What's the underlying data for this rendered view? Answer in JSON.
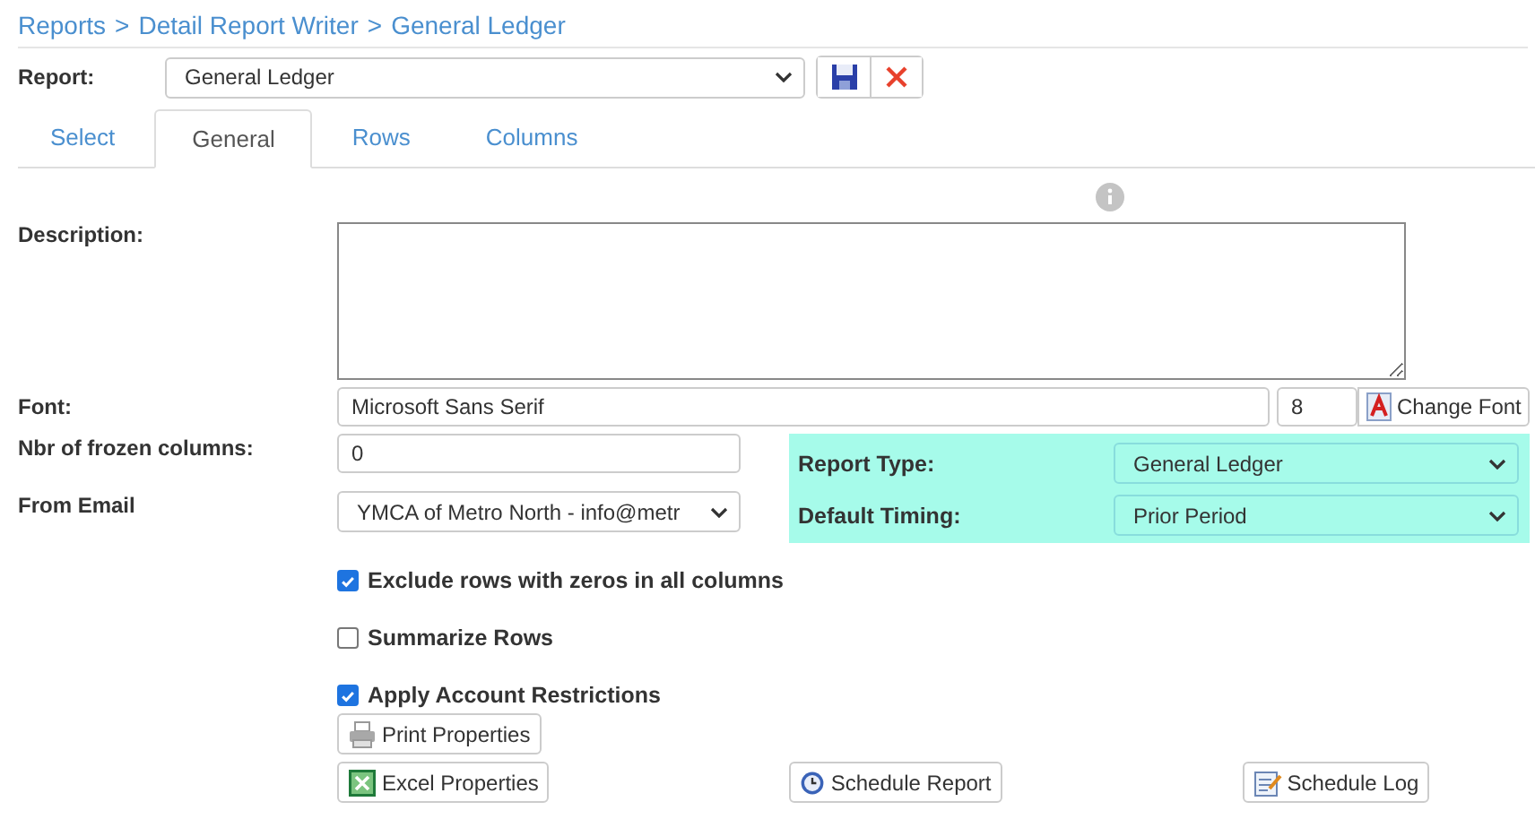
{
  "breadcrumb": [
    "Reports",
    "Detail Report Writer",
    "General Ledger"
  ],
  "breadcrumb_separator": ">",
  "report": {
    "label": "Report:",
    "value": "General Ledger"
  },
  "tabs": [
    {
      "label": "Select",
      "selected": false
    },
    {
      "label": "General",
      "selected": true
    },
    {
      "label": "Rows",
      "selected": false
    },
    {
      "label": "Columns",
      "selected": false
    }
  ],
  "description": {
    "label": "Description:"
  },
  "font": {
    "label": "Font:",
    "value": "Microsoft Sans Serif",
    "size": "8",
    "button": "Change Font"
  },
  "frozen": {
    "label": "Nbr of frozen columns:",
    "value": "0"
  },
  "from_email": {
    "label": "From Email",
    "value": "YMCA of Metro North - info@metr"
  },
  "report_type": {
    "label": "Report Type:",
    "value": "General Ledger"
  },
  "default_timing": {
    "label": "Default Timing:",
    "value": "Prior Period"
  },
  "checkboxes": [
    {
      "label": "Exclude rows with zeros in all columns",
      "checked": true
    },
    {
      "label": "Summarize Rows",
      "checked": false
    },
    {
      "label": "Apply Account Restrictions",
      "checked": true
    }
  ],
  "buttons": [
    {
      "label": "Print Properties",
      "kind": "print"
    },
    {
      "label": "Excel Properties",
      "kind": "excel"
    },
    {
      "label": "Schedule Report",
      "kind": "clock"
    },
    {
      "label": "Schedule Log",
      "kind": "log"
    }
  ]
}
